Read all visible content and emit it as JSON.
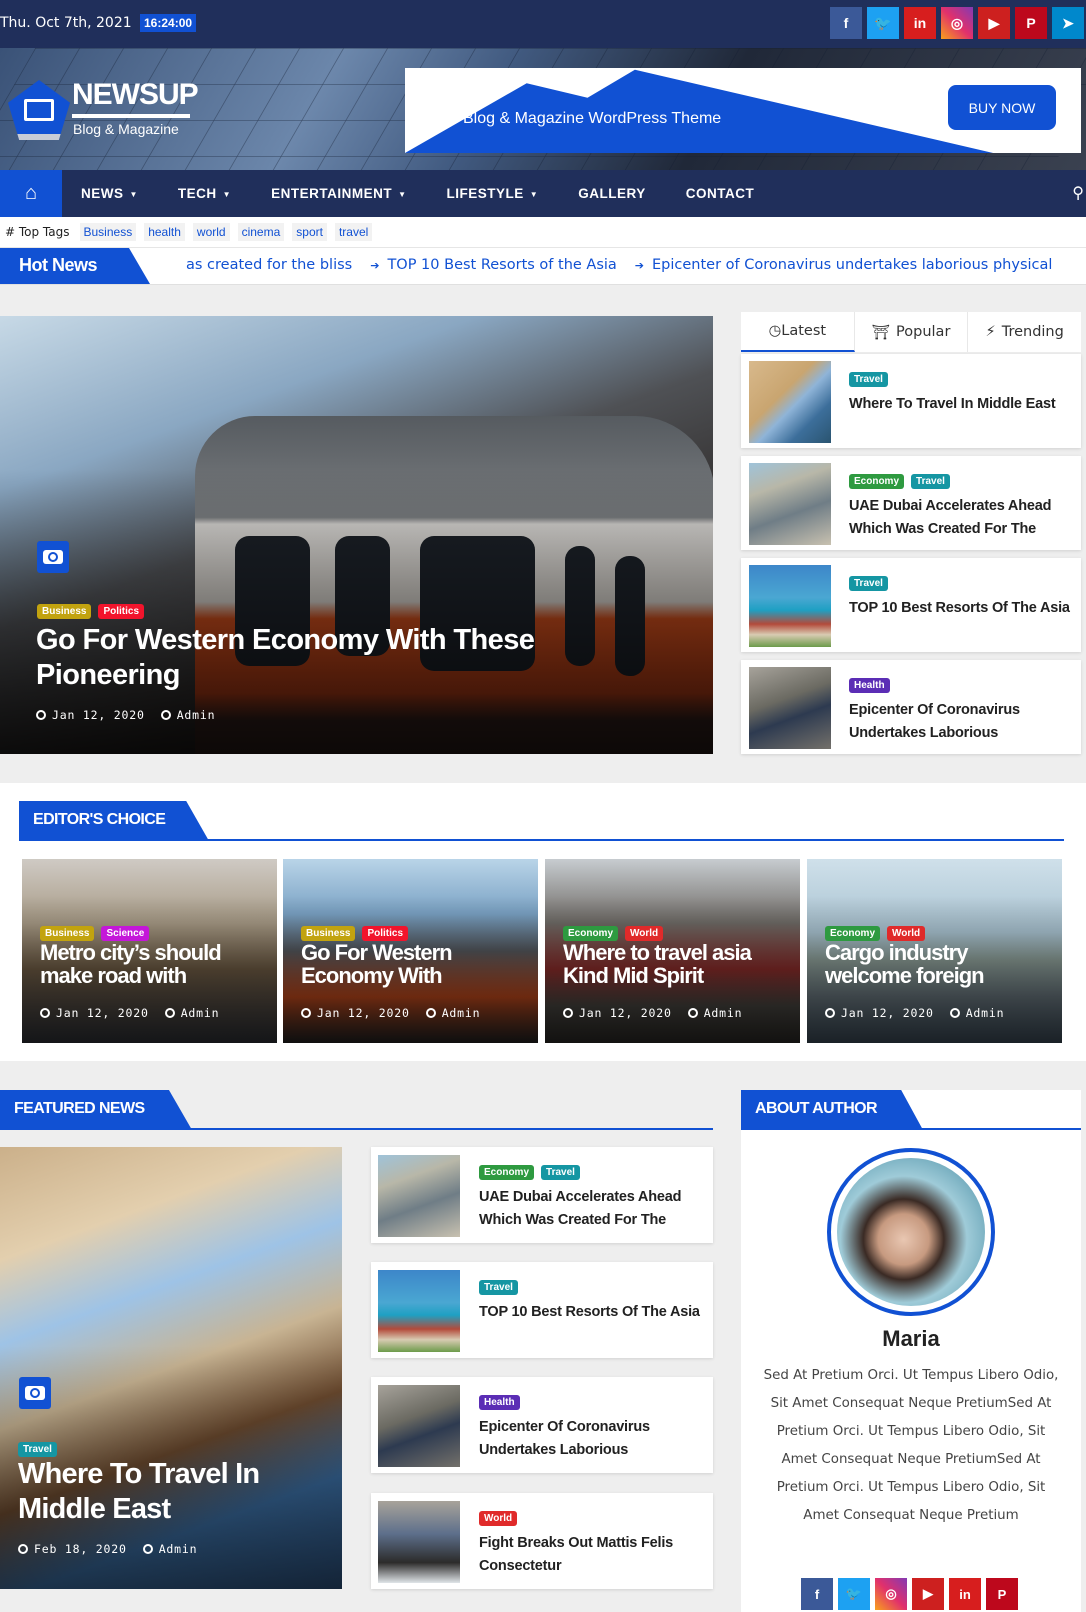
{
  "topbar": {
    "date": "Thu. Oct 7th, 2021",
    "time": "16:24:00",
    "social": [
      {
        "name": "facebook",
        "glyph": "f"
      },
      {
        "name": "twitter",
        "glyph": "🐦"
      },
      {
        "name": "linkedin",
        "glyph": "in"
      },
      {
        "name": "instagram",
        "glyph": "◎"
      },
      {
        "name": "youtube",
        "glyph": "▶"
      },
      {
        "name": "pinterest",
        "glyph": "P"
      },
      {
        "name": "telegram",
        "glyph": "➤"
      }
    ]
  },
  "header": {
    "logo_title": "NEWSUP",
    "logo_subtitle": "Blog & Magazine",
    "ad_text": "Blog & Magazine WordPress Theme",
    "ad_button": "BUY NOW"
  },
  "nav": {
    "home_icon": "⌂",
    "items": [
      {
        "label": "NEWS",
        "dropdown": true
      },
      {
        "label": "TECH",
        "dropdown": true
      },
      {
        "label": "ENTERTAINMENT",
        "dropdown": true
      },
      {
        "label": "LIFESTYLE",
        "dropdown": true
      },
      {
        "label": "GALLERY",
        "dropdown": false
      },
      {
        "label": "CONTACT",
        "dropdown": false
      }
    ],
    "search_icon": "🔍"
  },
  "tags": {
    "title": "# Top Tags",
    "items": [
      "Business",
      "health",
      "world",
      "cinema",
      "sport",
      "travel"
    ]
  },
  "hot_news": {
    "label": "Hot News",
    "items": [
      "as created for the bliss",
      "TOP 10 Best Resorts of the Asia",
      "Epicenter of Coronavirus undertakes laborious physical"
    ]
  },
  "hero": {
    "badges": [
      "Business",
      "Politics"
    ],
    "title": "Go For Western Economy With These Pioneering",
    "date": "Jan 12, 2020",
    "author": "Admin"
  },
  "sidebar_tabs": {
    "tabs": [
      {
        "label": "Latest",
        "icon": "clock-icon",
        "active": true
      },
      {
        "label": "Popular",
        "icon": "flame-icon",
        "active": false
      },
      {
        "label": "Trending",
        "icon": "bolt-icon",
        "active": false
      }
    ],
    "items": [
      {
        "badges": [
          "Travel"
        ],
        "title": "Where To Travel In Middle East"
      },
      {
        "badges": [
          "Economy",
          "Travel"
        ],
        "title": "UAE Dubai Accelerates Ahead Which Was Created For The"
      },
      {
        "badges": [
          "Travel"
        ],
        "title": "TOP 10 Best Resorts Of The Asia"
      },
      {
        "badges": [
          "Health"
        ],
        "title": "Epicenter Of Coronavirus Undertakes Laborious"
      }
    ]
  },
  "editors_choice": {
    "heading": "EDITOR'S CHOICE",
    "cards": [
      {
        "badges": [
          "Business",
          "Science"
        ],
        "title": "Metro city’s should make road with",
        "date": "Jan 12, 2020",
        "author": "Admin"
      },
      {
        "badges": [
          "Business",
          "Politics"
        ],
        "title": "Go For Western Economy With",
        "date": "Jan 12, 2020",
        "author": "Admin"
      },
      {
        "badges": [
          "Economy",
          "World"
        ],
        "title": "Where to travel asia Kind Mid Spirit",
        "date": "Jan 12, 2020",
        "author": "Admin"
      },
      {
        "badges": [
          "Economy",
          "World"
        ],
        "title": "Cargo industry welcome foreign",
        "date": "Jan 12, 2020",
        "author": "Admin"
      }
    ]
  },
  "featured_news": {
    "heading": "FEATURED NEWS",
    "main": {
      "badges": [
        "Travel"
      ],
      "title": "Where To Travel In Middle East",
      "date": "Feb 18, 2020",
      "author": "Admin"
    },
    "items": [
      {
        "badges": [
          "Economy",
          "Travel"
        ],
        "title": "UAE Dubai Accelerates Ahead Which Was Created For The"
      },
      {
        "badges": [
          "Travel"
        ],
        "title": "TOP 10 Best Resorts Of The Asia"
      },
      {
        "badges": [
          "Health"
        ],
        "title": "Epicenter Of Coronavirus Undertakes Laborious"
      },
      {
        "badges": [
          "World"
        ],
        "title": "Fight Breaks Out Mattis Felis Consectetur"
      }
    ]
  },
  "about_author": {
    "heading": "ABOUT AUTHOR",
    "name": "Maria",
    "bio": "Sed At Pretium Orci. Ut Tempus Libero Odio, Sit Amet Consequat Neque PretiumSed At Pretium Orci. Ut Tempus Libero Odio, Sit Amet Consequat Neque PretiumSed At Pretium Orci. Ut Tempus Libero Odio, Sit Amet Consequat Neque Pretium",
    "social": [
      {
        "name": "facebook",
        "glyph": "f"
      },
      {
        "name": "twitter",
        "glyph": "🐦"
      },
      {
        "name": "instagram",
        "glyph": "◎"
      },
      {
        "name": "youtube",
        "glyph": "▶"
      },
      {
        "name": "linkedin",
        "glyph": "in"
      },
      {
        "name": "pinterest",
        "glyph": "P"
      }
    ]
  },
  "colors": {
    "primary": "#1151d3",
    "navy": "#202f5b",
    "badge_business": "#c2a30f",
    "badge_politics": "#f2142c",
    "badge_travel": "#1596a3",
    "badge_economy": "#2e9a40",
    "badge_health": "#5b2db5",
    "badge_world": "#e02a2a",
    "badge_science": "#c417d9"
  }
}
